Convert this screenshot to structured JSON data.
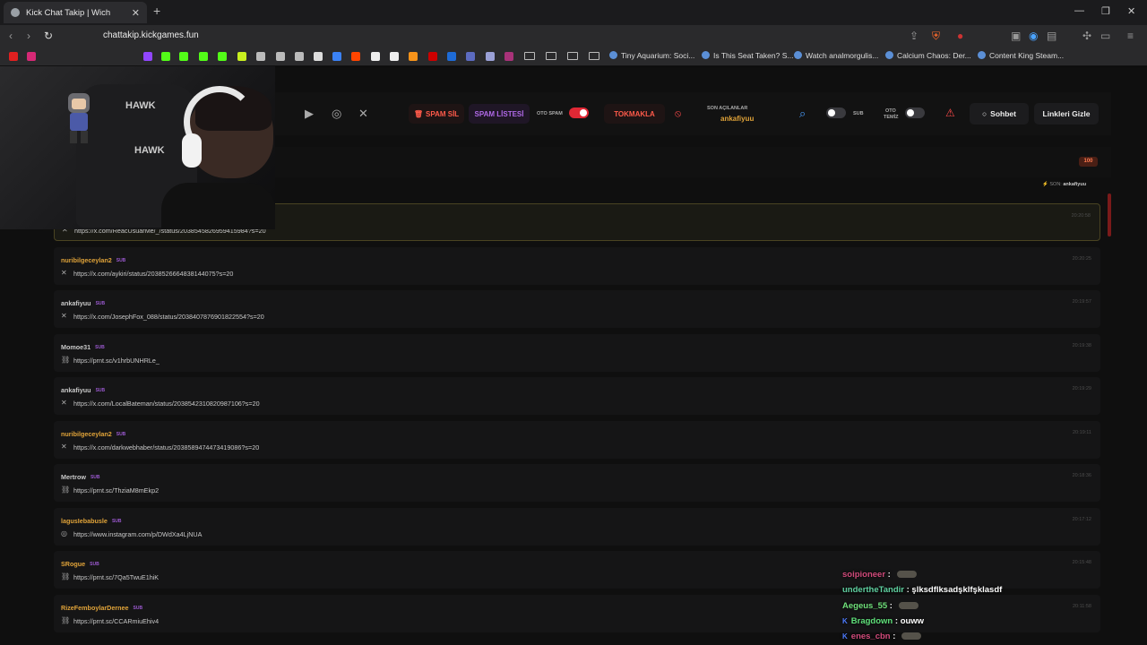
{
  "browser": {
    "tab_title": "Kick Chat Takip | Wich",
    "tab_close": "✕",
    "new_tab": "+",
    "url": "chattakip.kickgames.fun",
    "window_controls": [
      "—",
      "❐",
      "✕"
    ],
    "bookmarks": [
      {
        "label": "Tiny Aquarium: Soci..."
      },
      {
        "label": "Is This Seat Taken? S..."
      },
      {
        "label": "Watch analmorgulis..."
      },
      {
        "label": "Calcium Chaos: Der..."
      },
      {
        "label": "Content King Steam..."
      }
    ]
  },
  "toolbar": {
    "social_icons": [
      "youtube-icon",
      "instagram-icon",
      "x-icon"
    ],
    "spam_sil": "SPAM SİL",
    "spam_listesi": "SPAM LİSTESİ",
    "oto_spam_label": "OTO SPAM",
    "oto_spam_on": true,
    "tokmakla": "TOKMAKLA",
    "son_acilanlar_label": "SON AÇILANLAR",
    "son_acilanlar_user": "ankafiyuu",
    "sub_label": "SUB",
    "oto_temiz_label_1": "OTO",
    "oto_temiz_label_2": "TEMİZ",
    "sohbet": "Sohbet",
    "linkleri_gizle": "Linkleri Gizle"
  },
  "list": {
    "count": "100",
    "son_prefix": "SON:",
    "son_user": "ankafiyuu"
  },
  "messages": [
    {
      "user": "",
      "sub": "",
      "icon": "x-icon",
      "link": "https://x.com/ReacUsuarMe/_/status/2038545826959415984?s=20",
      "time": "20:20:58",
      "highlight": true
    },
    {
      "user": "nuribilgeceylan2",
      "sub": "SUB",
      "icon": "x-icon",
      "link": "https://x.com/aykiri/status/2038526664838144075?s=20",
      "time": "20:20:25",
      "color": "#e0a339"
    },
    {
      "user": "ankafiyuu",
      "sub": "SUB",
      "icon": "x-icon",
      "link": "https://x.com/JosephFox_088/status/2038407876901822554?s=20",
      "time": "20:19:57",
      "color": "#c9c9c9"
    },
    {
      "user": "Momoe31",
      "sub": "SUB",
      "icon": "link-icon",
      "link": "https://prnt.sc/v1hrbUNHRLe_",
      "time": "20:19:38",
      "color": "#c9c9c9"
    },
    {
      "user": "ankafiyuu",
      "sub": "SUB",
      "icon": "x-icon",
      "link": "https://x.com/LocalBateman/status/2038542310820987106?s=20",
      "time": "20:19:29",
      "color": "#c9c9c9"
    },
    {
      "user": "nuribilgeceylan2",
      "sub": "SUB",
      "icon": "x-icon",
      "link": "https://x.com/darkwebhaber/status/2038589474473419086?s=20",
      "time": "20:19:11",
      "color": "#e0a339"
    },
    {
      "user": "Mertrow",
      "sub": "SUB",
      "icon": "link-icon",
      "link": "https://prnt.sc/ThziaM8mEkp2",
      "time": "20:18:36",
      "color": "#c9c9c9"
    },
    {
      "user": "lagusIebabusle",
      "sub": "SUB",
      "icon": "instagram-icon",
      "link": "https://www.instagram.com/p/DWdXa4LjNUA",
      "time": "20:17:12",
      "color": "#e0a339"
    },
    {
      "user": "SRogue",
      "sub": "SUB",
      "icon": "link-icon",
      "link": "https://prnt.sc/7Qa5TwuE1hiK",
      "time": "20:15:48",
      "color": "#e0a339"
    },
    {
      "user": "RizeFemboylarDernee",
      "sub": "SUB",
      "icon": "link-icon",
      "link": "https://prnt.sc/CCARmiuEhiv4",
      "time": "20:11:58",
      "color": "#e0a339"
    }
  ],
  "chat_overlay": [
    {
      "user": "soipioneer",
      "text": "",
      "emote": true,
      "color": "#d04a7a",
      "kick": false
    },
    {
      "user": "undertheTandir",
      "text": "şlksdflksadşklfşklasdf",
      "emote": false,
      "color": "#5fd0a0",
      "kick": false
    },
    {
      "user": "Aegeus_55",
      "text": "",
      "emote": true,
      "color": "#6fe07a",
      "kick": false
    },
    {
      "user": "Bragdown",
      "text": "ouww",
      "emote": false,
      "color": "#5fe07a",
      "kick": true
    },
    {
      "user": "enes_cbn",
      "text": "",
      "emote": true,
      "color": "#d04a7a",
      "kick": true
    }
  ]
}
